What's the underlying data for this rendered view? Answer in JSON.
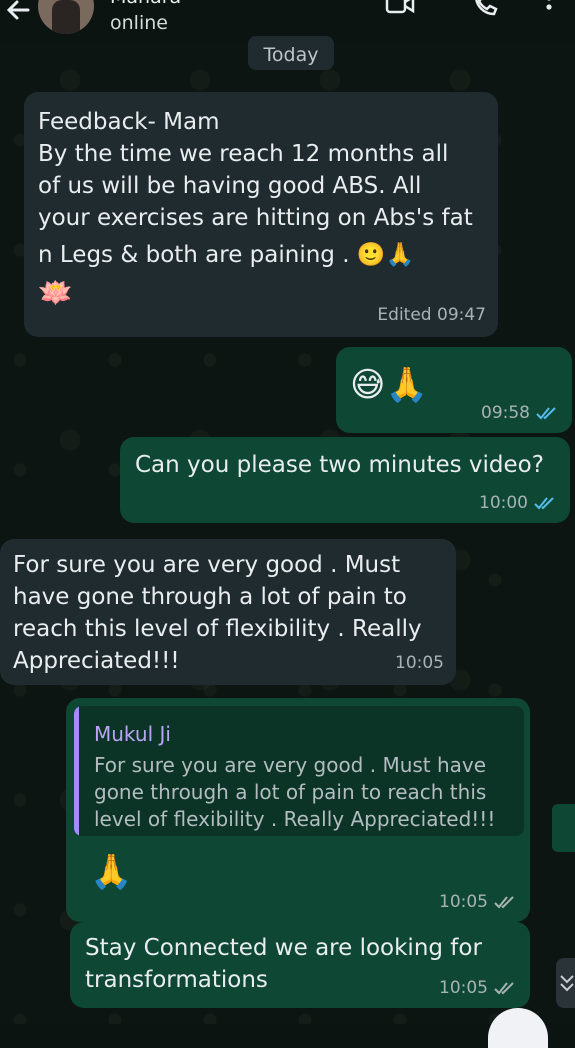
{
  "header": {
    "contact_name": "Manara",
    "status": "online"
  },
  "date_chip": "Today",
  "messages": {
    "m1": {
      "lines": [
        "Feedback- Mam",
        "By the time we reach 12 months all",
        "of us will be having good ABS. All",
        "your exercises are hitting on Abs's fat",
        "n Legs & both are paining  . 🙂🙏",
        "🪷"
      ],
      "meta": "Edited 09:47"
    },
    "m2": {
      "emoji": "😅🙏",
      "time": "09:58"
    },
    "m3": {
      "text": "Can you please two minutes video?",
      "time": "10:00"
    },
    "m4": {
      "lines": [
        "For sure you are very good . Must",
        "have gone through a lot of pain to",
        "reach this level of flexibility . Really",
        "Appreciated!!!"
      ],
      "time": "10:05"
    },
    "m5": {
      "quote_author": "Mukul Ji",
      "quote_lines": [
        "For sure you are very good . Must have",
        "gone through a lot of pain to reach this",
        "level of flexibility . Really Appreciated!!!"
      ],
      "emoji": "🙏",
      "time": "10:05"
    },
    "m6": {
      "lines": [
        "Stay Connected we are looking for",
        "transformations"
      ],
      "time": "10:05"
    }
  },
  "colors": {
    "incoming_bubble": "#1f2b2f",
    "outgoing_bubble": "#0f4735",
    "read_tick": "#53bdeb",
    "sent_tick": "#a8b3b4",
    "quote_bar": "#a78bfa"
  },
  "icons": [
    "back-arrow-icon",
    "video-call-icon",
    "phone-icon",
    "more-vert-icon",
    "read-receipt-icon",
    "delivered-icon",
    "scroll-down-icon"
  ]
}
